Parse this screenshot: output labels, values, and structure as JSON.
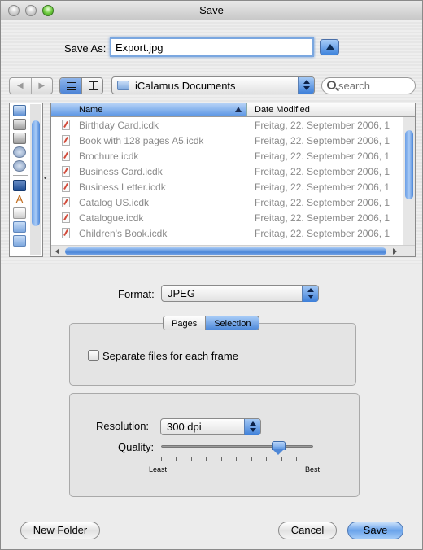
{
  "window": {
    "title": "Save"
  },
  "save_as": {
    "label": "Save As:",
    "value": "Export.jpg"
  },
  "location": {
    "folder": "iCalamus Documents"
  },
  "search": {
    "placeholder": "search"
  },
  "file_list": {
    "columns": [
      "Name",
      "Date Modified"
    ],
    "rows": [
      {
        "name": "Birthday Card.icdk",
        "date": "Freitag, 22. September 2006, 1"
      },
      {
        "name": "Book with 128 pages A5.icdk",
        "date": "Freitag, 22. September 2006, 1"
      },
      {
        "name": "Brochure.icdk",
        "date": "Freitag, 22. September 2006, 1"
      },
      {
        "name": "Business Card.icdk",
        "date": "Freitag, 22. September 2006, 1"
      },
      {
        "name": "Business Letter.icdk",
        "date": "Freitag, 22. September 2006, 1"
      },
      {
        "name": "Catalog US.icdk",
        "date": "Freitag, 22. September 2006, 1"
      },
      {
        "name": "Catalogue.icdk",
        "date": "Freitag, 22. September 2006, 1"
      },
      {
        "name": "Children's Book.icdk",
        "date": "Freitag, 22. September 2006, 1"
      }
    ]
  },
  "format": {
    "label": "Format:",
    "value": "JPEG"
  },
  "tabs": [
    {
      "label": "Pages",
      "active": false
    },
    {
      "label": "Selection",
      "active": true
    }
  ],
  "separate_files": {
    "label": "Separate files for each frame",
    "checked": false
  },
  "resolution": {
    "label": "Resolution:",
    "value": "300 dpi"
  },
  "quality": {
    "label": "Quality:",
    "min_label": "Least",
    "max_label": "Best",
    "level": 0.77
  },
  "buttons": {
    "new_folder": "New Folder",
    "cancel": "Cancel",
    "save": "Save"
  }
}
